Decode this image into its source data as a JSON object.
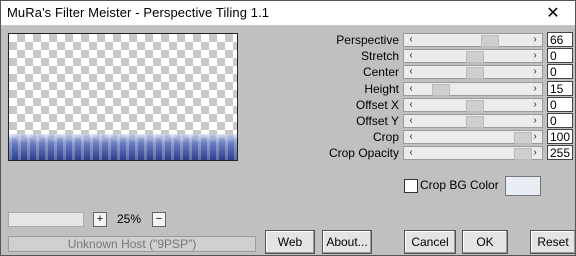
{
  "window": {
    "title": "MuRa's Filter Meister - Perspective Tiling 1.1",
    "close": "✕"
  },
  "zoom": {
    "minus": "−",
    "plus": "+",
    "value": "25%"
  },
  "status": "Unknown Host (\"9PSP\")",
  "sliders": [
    {
      "label": "Perspective",
      "value": "66",
      "fraction": 0.66
    },
    {
      "label": "Stretch",
      "value": "0",
      "fraction": 0.5
    },
    {
      "label": "Center",
      "value": "0",
      "fraction": 0.5
    },
    {
      "label": "Height",
      "value": "15",
      "fraction": 0.15
    },
    {
      "label": "Offset X",
      "value": "0",
      "fraction": 0.5
    },
    {
      "label": "Offset Y",
      "value": "0",
      "fraction": 0.5
    },
    {
      "label": "Crop",
      "value": "100",
      "fraction": 1.0
    },
    {
      "label": "Crop Opacity",
      "value": "255",
      "fraction": 1.0
    }
  ],
  "crop_bg": {
    "label": "Crop BG Color",
    "checked": false,
    "color": "#e8eef4"
  },
  "buttons": {
    "web": "Web",
    "about": "About...",
    "cancel": "Cancel",
    "ok": "OK",
    "reset": "Reset"
  }
}
